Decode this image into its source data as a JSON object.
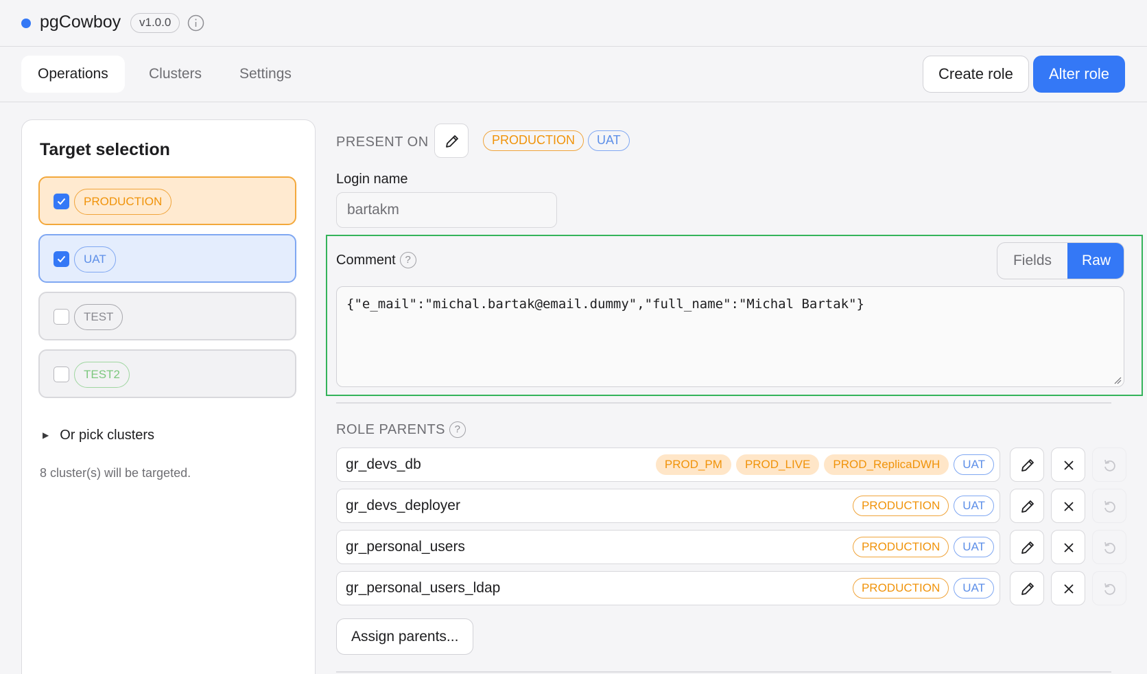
{
  "app": {
    "name": "pgCowboy",
    "version": "v1.0.0"
  },
  "nav": {
    "tabs": [
      {
        "label": "Operations",
        "active": true
      },
      {
        "label": "Clusters",
        "active": false
      },
      {
        "label": "Settings",
        "active": false
      }
    ],
    "create_role": "Create role",
    "alter_role": "Alter role"
  },
  "sidebar": {
    "title": "Target selection",
    "targets": [
      {
        "label": "PRODUCTION",
        "checked": true,
        "color": "#f0930a"
      },
      {
        "label": "UAT",
        "checked": true,
        "color": "#5d8fe8"
      },
      {
        "label": "TEST",
        "checked": false,
        "color": "#8a8a90"
      },
      {
        "label": "TEST2",
        "checked": false,
        "color": "#7cc77e"
      }
    ],
    "pick_clusters": "Or pick clusters",
    "note": "8 cluster(s) will be targeted."
  },
  "present_on": {
    "label": "PRESENT ON",
    "pills": [
      "PRODUCTION",
      "UAT"
    ]
  },
  "login": {
    "label": "Login name",
    "value": "bartakm"
  },
  "comment": {
    "label": "Comment",
    "help": "?",
    "modes": [
      "Fields",
      "Raw"
    ],
    "active_mode": "Raw",
    "value": "{\"e_mail\":\"michal.bartak@email.dummy\",\"full_name\":\"Michal Bartak\"}"
  },
  "role_parents": {
    "label": "ROLE PARENTS",
    "help": "?",
    "rows": [
      {
        "name": "gr_devs_db",
        "p1": "PROD_PM",
        "p2": "PROD_LIVE",
        "p3": "PROD_ReplicaDWH",
        "p4": "UAT"
      },
      {
        "name": "gr_devs_deployer",
        "p1": "PRODUCTION",
        "p2": "UAT"
      },
      {
        "name": "gr_personal_users",
        "p1": "PRODUCTION",
        "p2": "UAT"
      },
      {
        "name": "gr_personal_users_ldap",
        "p1": "PRODUCTION",
        "p2": "UAT"
      }
    ],
    "assign_button": "Assign parents..."
  },
  "colors": {
    "accent": "#3478f6",
    "production": "#f0930a",
    "uat": "#5d8fe8",
    "highlight": "#34b35a"
  }
}
